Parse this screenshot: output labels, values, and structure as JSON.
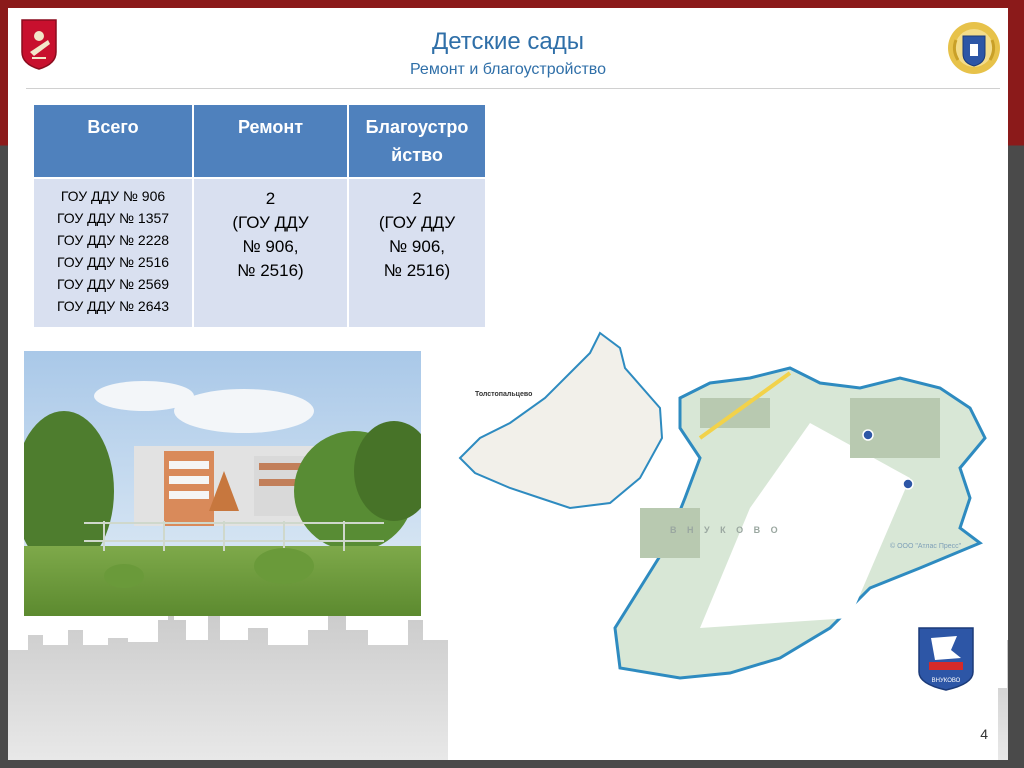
{
  "header": {
    "title": "Детские сады",
    "subtitle": "Ремонт и благоустройство"
  },
  "table": {
    "headers": [
      "Всего",
      "Ремонт",
      "Благоустро йство"
    ],
    "header_lines": {
      "col1": [
        "Всего"
      ],
      "col2": [
        "Ремонт"
      ],
      "col3": [
        "Благоустро",
        "йство"
      ]
    },
    "schools": [
      "ГОУ ДДУ № 906",
      "ГОУ ДДУ № 1357",
      "ГОУ ДДУ № 2228",
      "ГОУ ДДУ № 2516",
      "ГОУ ДДУ № 2569",
      "ГОУ ДДУ № 2643"
    ],
    "repair": [
      "2",
      "(ГОУ ДДУ",
      "№ 906,",
      "№ 2516)"
    ],
    "improvement": [
      "2",
      "(ГОУ ДДУ",
      "№ 906,",
      "№ 2516)"
    ]
  },
  "map": {
    "label_tolsto": "Толстопальцево",
    "label_vnukovo": "В Н У К О В О",
    "copyright": "© ООО \"Атлас Пресс\""
  },
  "district_logo_text": "ВНУКОВО",
  "page_number": "4",
  "colors": {
    "accent": "#2f6fa8",
    "table_header": "#4f81bd",
    "table_cell": "#d9e0f0",
    "frame_red": "#8b1a1a"
  }
}
